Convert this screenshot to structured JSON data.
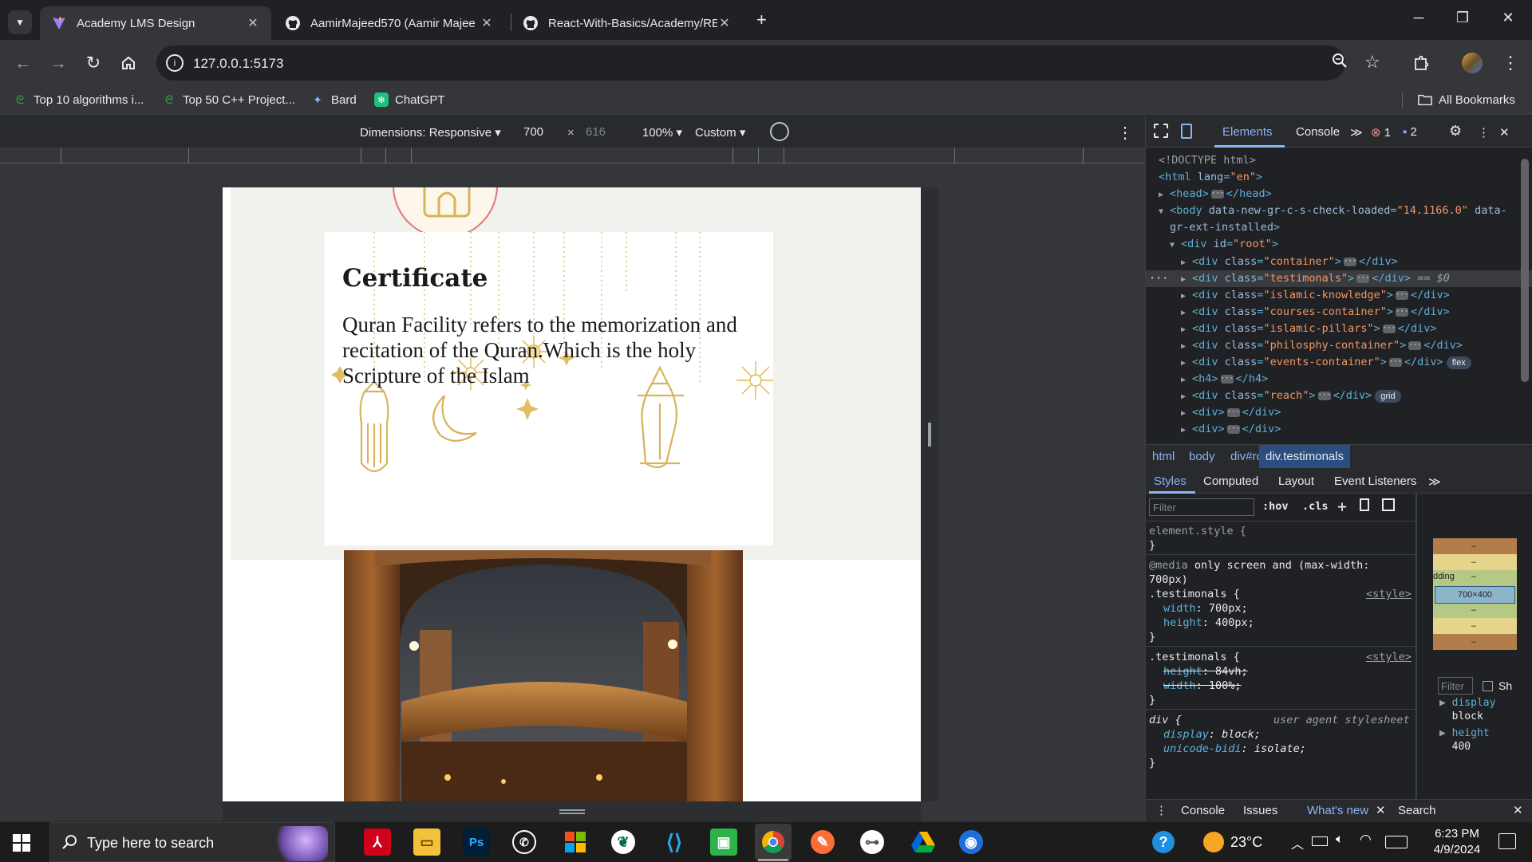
{
  "browser": {
    "tabs": [
      {
        "title": "Academy LMS Design",
        "active": true
      },
      {
        "title": "AamirMajeed570 (Aamir Majee",
        "active": false
      },
      {
        "title": "React-With-Basics/Academy/RE",
        "active": false
      }
    ],
    "url": "127.0.0.1:5173",
    "bookmarks": [
      "Top 10 algorithms i...",
      "Top 50 C++ Project...",
      "Bard",
      "ChatGPT"
    ],
    "all_bookmarks": "All Bookmarks"
  },
  "device_toolbar": {
    "dimensions": "Dimensions: Responsive",
    "width": "700",
    "times": "×",
    "height": "616",
    "zoom": "100%",
    "throttle": "Custom"
  },
  "page": {
    "certificate_title": "Certificate",
    "certificate_text": "Quran Facility refers to the memorization and recitation of the Quran.Which is the holy Scripture of the Islam"
  },
  "devtools": {
    "tabs": [
      "Elements",
      "Console"
    ],
    "errors": "1",
    "messages": "2",
    "dom": {
      "doctype": "<!DOCTYPE html>",
      "html_open": "html",
      "html_attr": "lang",
      "html_val": "\"en\"",
      "head": "head",
      "body": "body",
      "body_attr1": "data-new-gr-c-s-check-loaded",
      "body_val1": "\"14.1166.0\"",
      "body_attr2a": "data-",
      "body_attr2b": "gr-ext-installed",
      "root_attr": "id",
      "root_val": "\"root\"",
      "children": [
        {
          "cls": "\"container\""
        },
        {
          "cls": "\"testimonals\""
        },
        {
          "cls": "\"islamic-knowledge\""
        },
        {
          "cls": "\"courses-container\""
        },
        {
          "cls": "\"islamic-pillars\""
        },
        {
          "cls": "\"philosphy-container\""
        },
        {
          "cls": "\"events-container\""
        }
      ],
      "selected_suffix": "== $0",
      "flex_badge": "flex",
      "grid_badge": "grid",
      "h4": "h4",
      "reach_cls": "\"reach\"",
      "div": "div"
    },
    "breadcrumbs": [
      "html",
      "body",
      "div#root",
      "div.testimonals"
    ],
    "style_tabs": [
      "Styles",
      "Computed",
      "Layout",
      "Event Listeners"
    ],
    "filter_placeholder": "Filter",
    "hov": ":hov",
    "cls": ".cls",
    "styles": {
      "element_style": "element.style {",
      "close": "}",
      "media_kw": "@media",
      "media_rest": "only screen and (max-width:",
      "media_rest2": "700px)",
      "selector": ".testimonals {",
      "source": "<style>",
      "rule1": [
        {
          "prop": "width",
          "val": "700px;"
        },
        {
          "prop": "height",
          "val": "400px;"
        }
      ],
      "rule2": [
        {
          "prop": "height",
          "val": "84vh;"
        },
        {
          "prop": "width",
          "val": "100%;"
        }
      ],
      "div_sel": "div {",
      "ua": "user agent stylesheet",
      "rule3": [
        {
          "prop": "display",
          "val": "block;"
        },
        {
          "prop": "unicode-bidi",
          "val": "isolate;"
        }
      ]
    },
    "boxmodel": {
      "size": "700×400",
      "dash": "–",
      "padding_label": "dding",
      "filter": "Filter",
      "show": "Sh",
      "computed": [
        {
          "prop": "display",
          "val": "block"
        },
        {
          "prop": "height",
          "val": "400"
        }
      ]
    },
    "drawer_tabs": [
      "Console",
      "Issues",
      "What's new",
      "Search"
    ]
  },
  "taskbar": {
    "search_placeholder": "Type here to search",
    "temperature": "23°C",
    "time": "6:23 PM",
    "date": "4/9/2024",
    "apps": [
      "acrobat",
      "file-explorer",
      "photoshop",
      "whatsapp",
      "microsoft-store",
      "mongodb",
      "vscode",
      "camtasia",
      "chrome",
      "postman",
      "keys",
      "google-drive",
      "messenger"
    ]
  },
  "colors": {
    "accent": "#8ab4f8",
    "selected_row": "#393b3f",
    "gold": "#d8b35a"
  }
}
